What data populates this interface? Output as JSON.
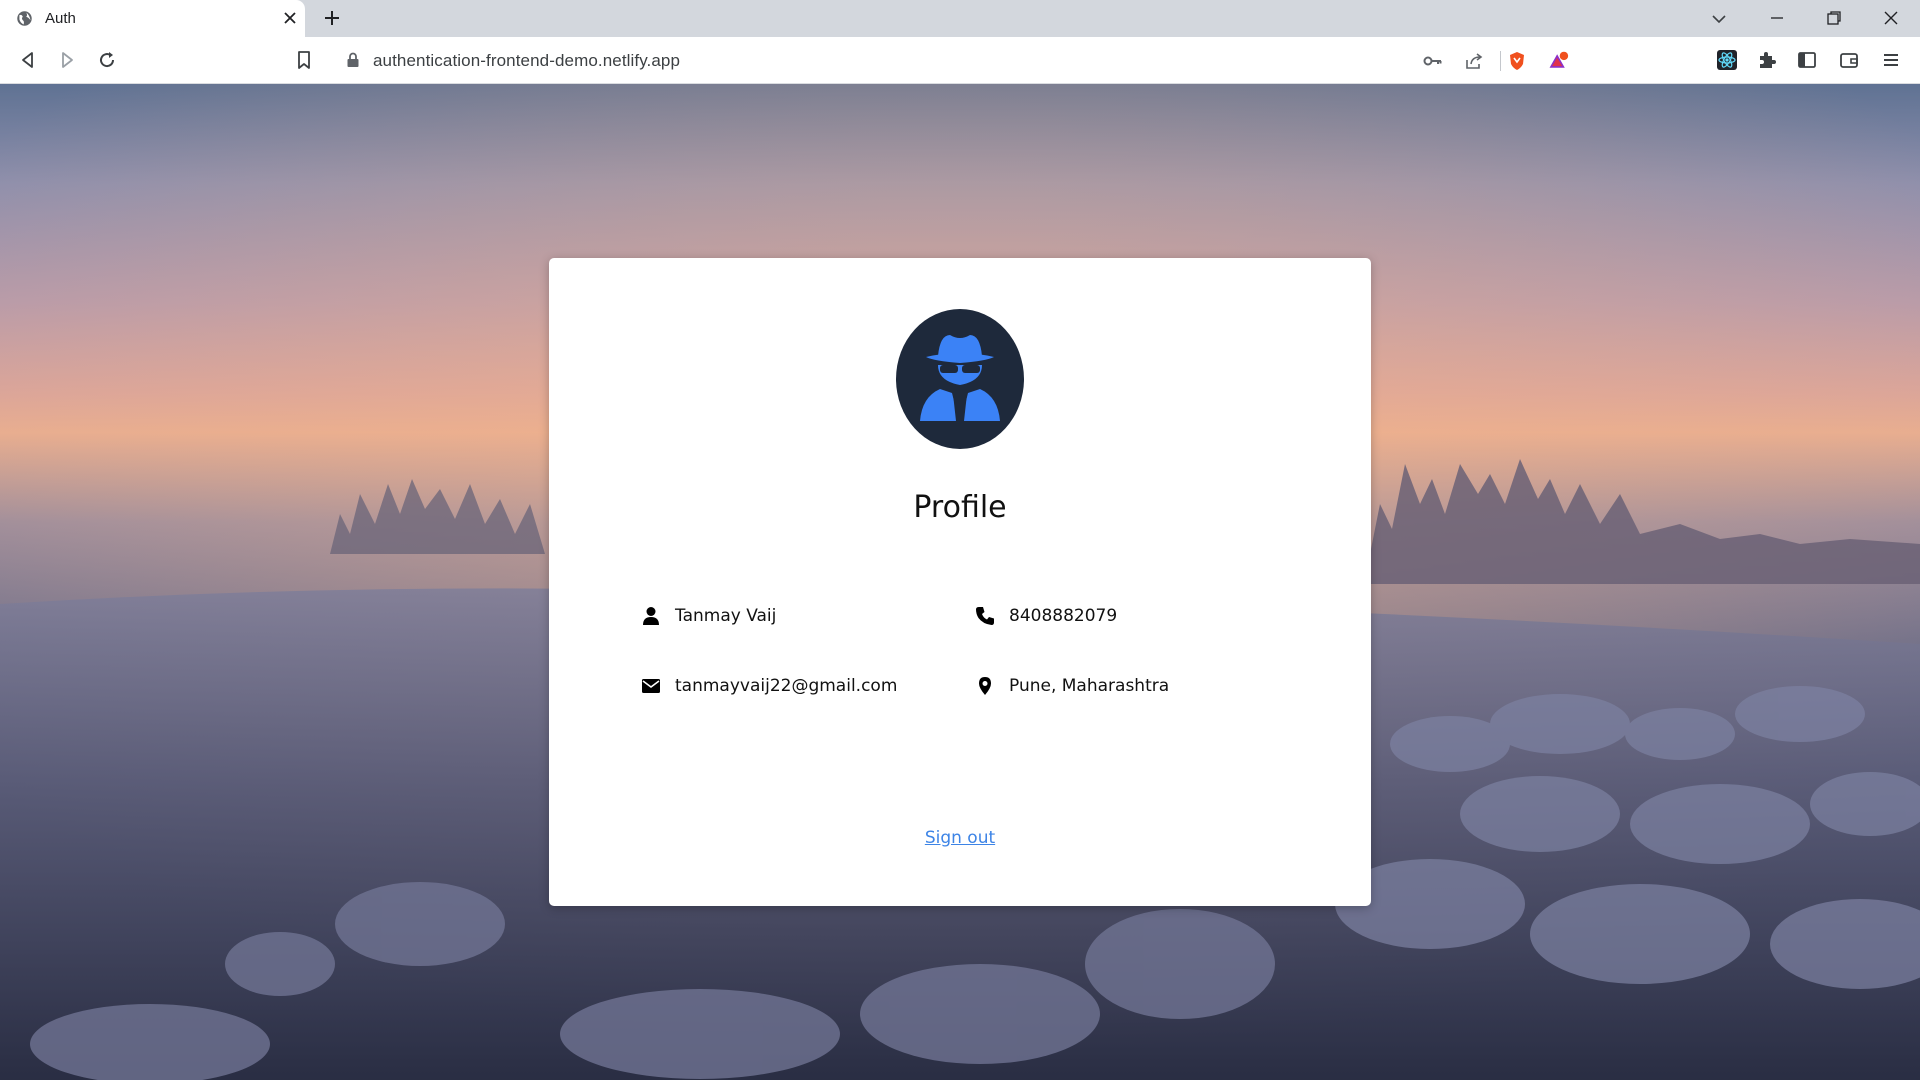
{
  "browser": {
    "tab": {
      "title": "Auth",
      "favicon": "globe-icon"
    },
    "address_bar": {
      "url": "authentication-frontend-demo.netlify.app"
    },
    "icons": [
      "back-icon",
      "forward-icon",
      "reload-icon",
      "bookmark-icon",
      "lock-icon",
      "key-icon",
      "share-icon",
      "brave-shields-icon",
      "brave-rewards-icon",
      "react-devtools-icon",
      "extensions-icon",
      "sidebar-icon",
      "wallet-icon",
      "menu-icon"
    ]
  },
  "profile": {
    "avatar_icon": "user-secret-icon",
    "title": "Profile",
    "name": "Tanmay Vaij",
    "phone": "8408882079",
    "email": "tanmayvaij22@gmail.com",
    "location": "Pune, Maharashtra",
    "sign_out_label": "Sign out"
  },
  "colors": {
    "avatar_bg": "#1e293b",
    "avatar_fg": "#3b82f6",
    "link": "#3d84e6"
  }
}
